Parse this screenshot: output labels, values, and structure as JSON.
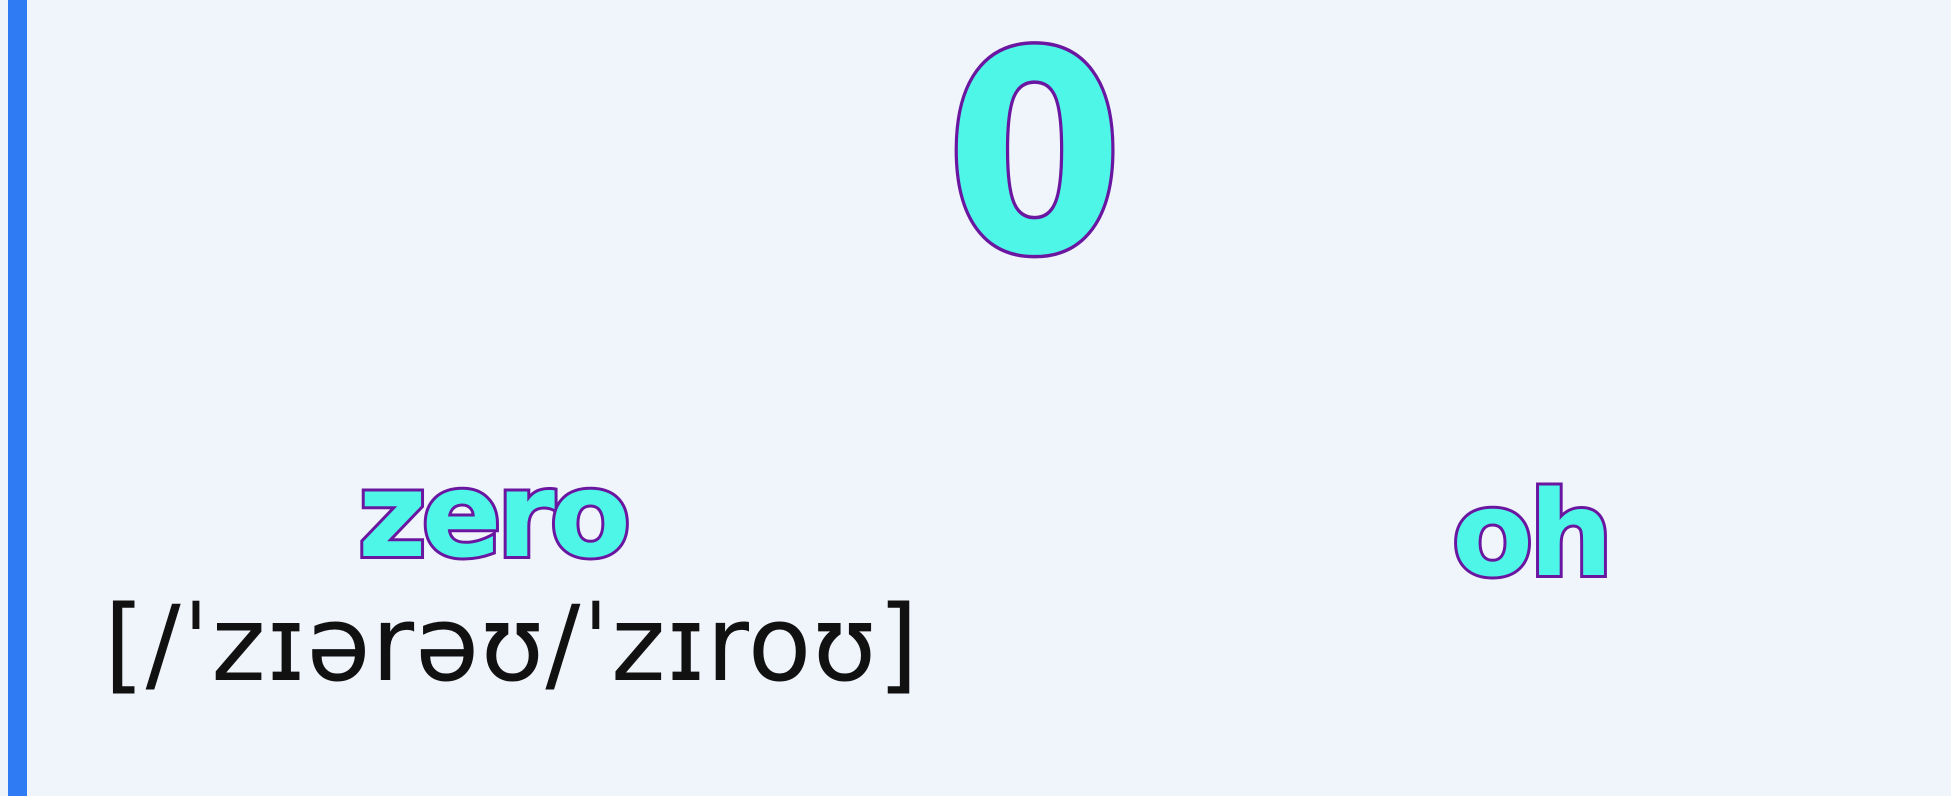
{
  "screen": {
    "number": "0",
    "words": [
      {
        "text": "zero",
        "pronunciation": "[/ˈzɪərəʊ/ˈzɪroʊ]"
      },
      {
        "text": "oh"
      }
    ]
  },
  "colors": {
    "background": "#f0f4fb",
    "accent_bar": "#2f7bf4",
    "text_fill": "#4ef6e8",
    "text_outline": "#6a16a0",
    "pronunciation_text": "#111111"
  }
}
